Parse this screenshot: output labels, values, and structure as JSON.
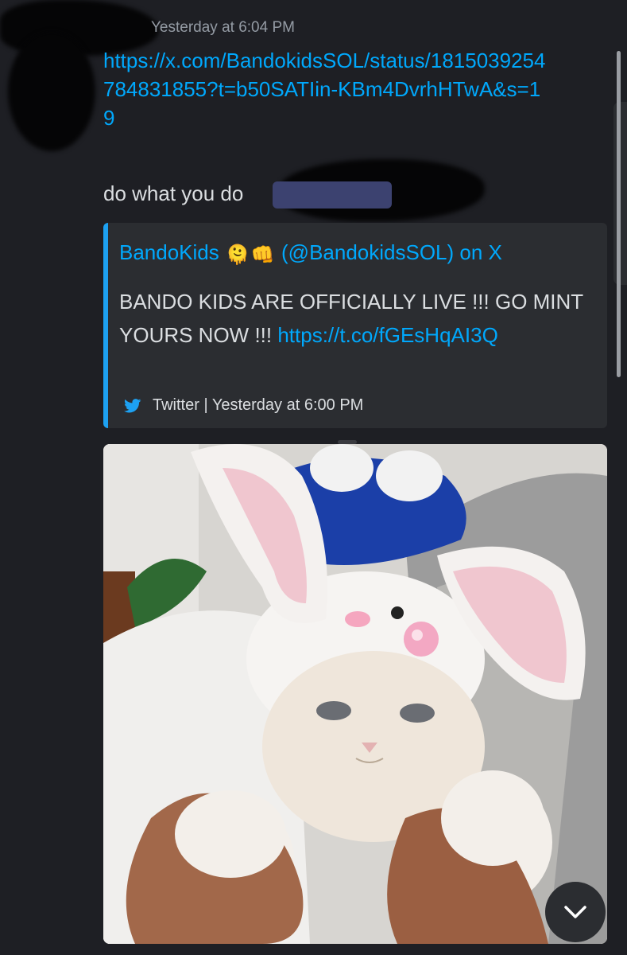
{
  "message": {
    "timestamp": "Yesterday at 6:04 PM",
    "link": "https://x.com/BandokidsSOL/status/1815039254784831855?t=b50SATIin-KBm4DvrhHTwA&s=19",
    "text": "do what you do"
  },
  "embed": {
    "title_prefix": "BandoKids",
    "emoji_1": "🫠",
    "emoji_2": "👊",
    "title_suffix": "(@BandokidsSOL) on X",
    "description": "BANDO KIDS ARE OFFICIALLY LIVE !!! GO MINT YOURS NOW !!! ",
    "description_link": "https://t.co/fGEsHqAI3Q",
    "footer": "Twitter | Yesterday at 6:00 PM",
    "accent_color": "#1da1f2",
    "footer_icon": "twitter-bird-icon"
  },
  "media": {
    "icon": "chevron-down-icon"
  },
  "colors": {
    "background": "#1e1f24",
    "link": "#00a8fc",
    "embed_bg": "#2b2d31"
  }
}
